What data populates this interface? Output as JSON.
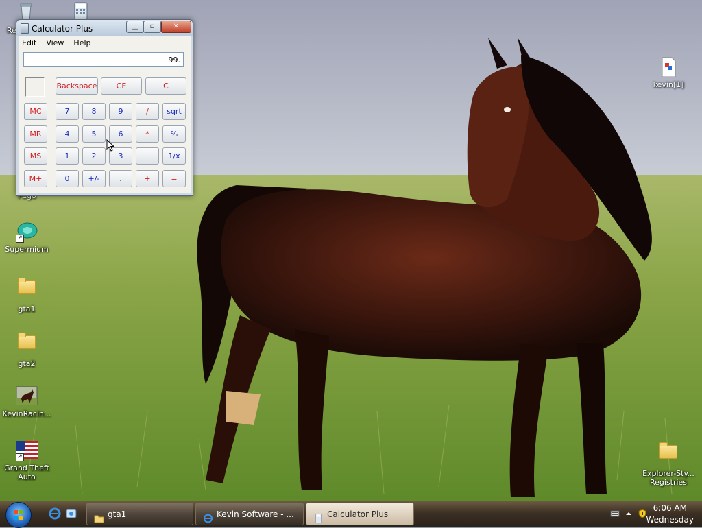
{
  "desktop": {
    "icons_left": [
      {
        "label": "Re",
        "icon": "recycle-bin-icon"
      },
      {
        "label": "Pego",
        "icon": "app-icon"
      },
      {
        "label": "Supermium",
        "icon": "supermium-icon"
      },
      {
        "label": "gta1",
        "icon": "folder-icon"
      },
      {
        "label": "gta2",
        "icon": "folder-icon"
      },
      {
        "label": "KevinRacin...",
        "icon": "horse-image-icon"
      },
      {
        "label": "Grand Theft Auto",
        "icon": "gta-flag-icon"
      }
    ],
    "icons_right": [
      {
        "label": "kevin[1]",
        "icon": "document-icon"
      },
      {
        "label": "Explorer-Sty... Registries",
        "icon": "folder-icon"
      }
    ]
  },
  "calculator": {
    "title": "Calculator Plus",
    "menu": [
      "Edit",
      "View",
      "Help"
    ],
    "display": "99.",
    "buttons": {
      "backspace": "Backspace",
      "ce": "CE",
      "c": "C",
      "mc": "MC",
      "mr": "MR",
      "ms": "MS",
      "mplus": "M+",
      "n7": "7",
      "n8": "8",
      "n9": "9",
      "div": "/",
      "sqrt": "sqrt",
      "n4": "4",
      "n5": "5",
      "n6": "6",
      "mul": "*",
      "pct": "%",
      "n1": "1",
      "n2": "2",
      "n3": "3",
      "sub": "−",
      "inv": "1/x",
      "n0": "0",
      "sign": "+/-",
      "dot": ".",
      "add": "+",
      "eq": "="
    }
  },
  "taskbar": {
    "tasks": [
      {
        "label": "gta1",
        "icon": "folder-icon"
      },
      {
        "label": "Kevin Software - ...",
        "icon": "ie-icon"
      },
      {
        "label": "Calculator Plus",
        "icon": "calculator-icon"
      }
    ],
    "clock": {
      "time": "6:06 AM",
      "day": "Wednesday"
    }
  },
  "colors": {
    "taskbar": "#3c3024",
    "accent_red": "#d21b1b",
    "accent_blue": "#1a2fbf"
  }
}
